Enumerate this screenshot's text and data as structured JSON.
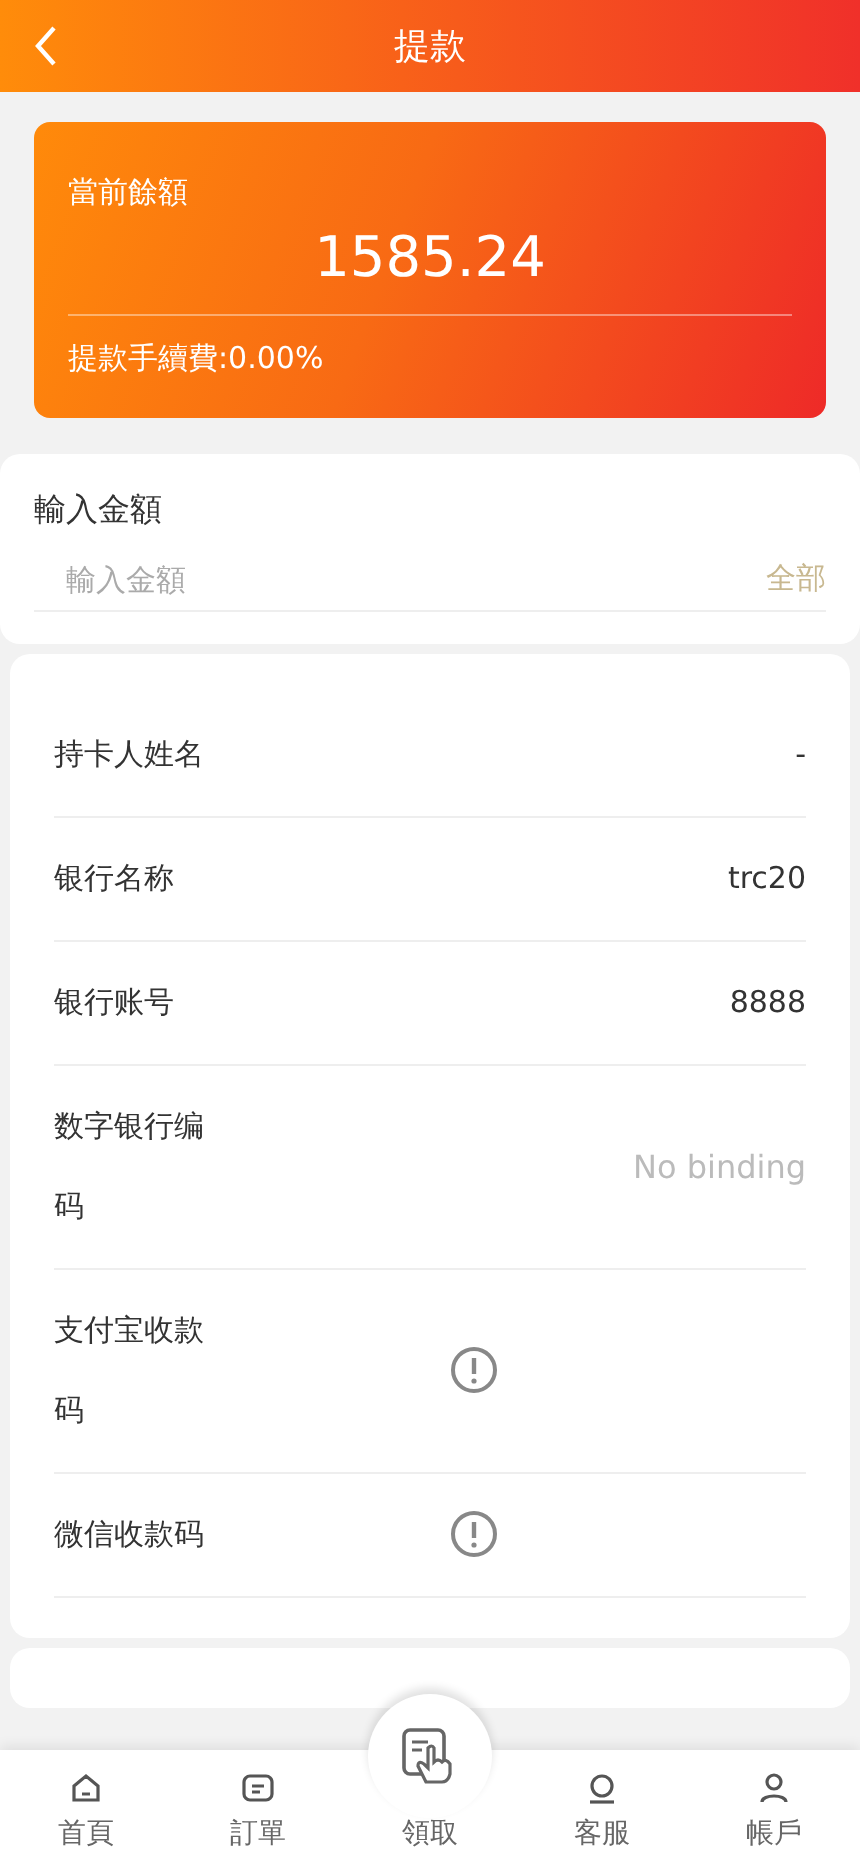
{
  "header": {
    "title": "提款"
  },
  "balance": {
    "label": "當前餘額",
    "amount": "1585.24",
    "fee": "提款手續費:0.00%"
  },
  "amount_input": {
    "label": "輸入金額",
    "placeholder": "輸入金額",
    "all_link": "全部"
  },
  "details": [
    {
      "kind": "text",
      "label": "持卡人姓名",
      "value": "-"
    },
    {
      "kind": "text",
      "label": "银行名称",
      "value": "trc20"
    },
    {
      "kind": "text",
      "label": "银行账号",
      "value": "8888"
    },
    {
      "kind": "muted",
      "label": "数字银行编码",
      "value": "No binding"
    },
    {
      "kind": "alert",
      "label": "支付宝收款码"
    },
    {
      "kind": "alert",
      "label": "微信收款码"
    }
  ],
  "tab_bar": [
    {
      "kind": "home",
      "label": "首頁"
    },
    {
      "kind": "orders",
      "label": "訂單"
    },
    {
      "kind": "claim",
      "label": "領取"
    },
    {
      "kind": "service",
      "label": "客服"
    },
    {
      "kind": "account",
      "label": "帳戶"
    }
  ]
}
